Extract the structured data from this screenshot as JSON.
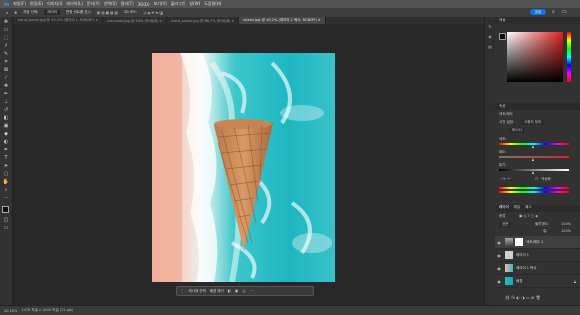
{
  "menu": {
    "items": [
      "파일(F)",
      "편집(E)",
      "이미지(I)",
      "레이어(L)",
      "문자(Y)",
      "선택(S)",
      "필터(T)",
      "3D(D)",
      "보기(V)",
      "플러그인",
      "창(W)",
      "도움말(H)"
    ],
    "share_label": "공유"
  },
  "options_bar": {
    "items": [
      "자동 선택:",
      "레이어",
      "변형 컨트롤 표시",
      "3D 모드:"
    ]
  },
  "tabs": [
    {
      "label": "hand_saeon.jpg @ 43.3% (레이어 1, RGB/8*) ×",
      "active": false
    },
    {
      "label": "icecream.jpg @ 50% (RGB/8) ×",
      "active": false
    },
    {
      "label": "hand_saeon.jpg @ 66.7% (RGB/8) ×",
      "active": false
    },
    {
      "label": "ocean.jpg @ 40.2% (레이어 1 복사, RGB/8*) ×",
      "active": true
    }
  ],
  "taskbar": {
    "items": [
      "피사체 선택",
      "배경 제거",
      "···"
    ]
  },
  "status": {
    "zoom": "40.18%",
    "info": "1476 픽셀 x 1845 픽셀 (72 ppi)"
  },
  "color_panel": {
    "title": "색상",
    "hue_color": "#e02020"
  },
  "properties_panel": {
    "title": "속성",
    "subtitle": "색조/채도",
    "preset_label": "사전 설정:",
    "preset_value": "사용자 정의",
    "channel_value": "마스터",
    "rows": [
      "색조:",
      "채도:",
      "밝기:"
    ],
    "colorize_label": "색상화"
  },
  "layers_panel": {
    "tabs": [
      "레이어",
      "채널",
      "패스"
    ],
    "kind_label": "종류",
    "blend_mode": "표준",
    "opacity_label": "불투명도:",
    "opacity": "100%",
    "fill_label": "칠:",
    "fill": "100%",
    "layers": [
      {
        "name": "색조/채도 1",
        "type": "adjustment"
      },
      {
        "name": "레이어 1",
        "type": "cone"
      },
      {
        "name": "레이어 1 복사",
        "type": "ocean"
      },
      {
        "name": "배경",
        "type": "ocean"
      }
    ]
  }
}
